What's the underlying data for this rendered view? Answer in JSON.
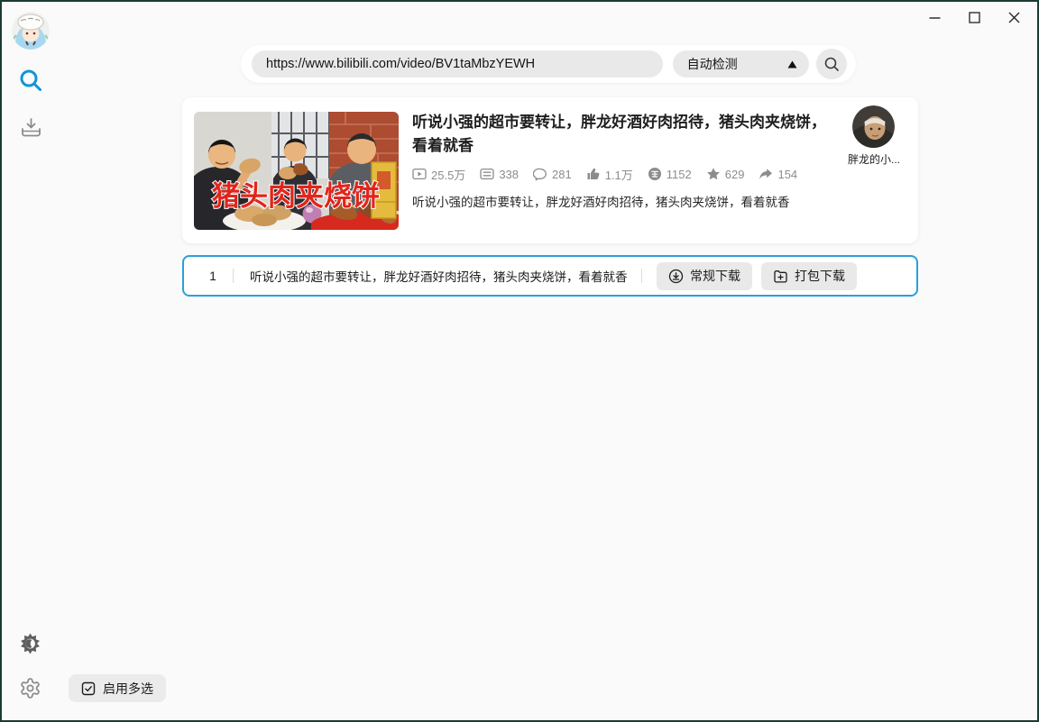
{
  "colors": {
    "accent_blue": "#28a0da",
    "sidebar_search_blue": "#1095d8",
    "window_border": "#1d3a34",
    "thumbnail_text_red": "#e1251b",
    "button_gray": "#e9e9e9"
  },
  "icons": [
    "app-avatar",
    "search-icon",
    "download-tray-icon",
    "theme-toggle-icon",
    "settings-gear-icon",
    "checkbox-checked-icon",
    "play-count-icon",
    "danmaku-icon",
    "comment-icon",
    "like-icon",
    "coin-icon",
    "favorite-star-icon",
    "share-icon",
    "cloud-download-icon",
    "package-add-icon",
    "magnifier-icon",
    "dropdown-up-triangle-icon",
    "minimize-icon",
    "maximize-icon",
    "close-icon"
  ],
  "search_bar": {
    "url": "https://www.bilibili.com/video/BV1taMbzYEWH",
    "detect_mode": "自动检测"
  },
  "video_card": {
    "title": "听说小强的超市要转让，胖龙好酒好肉招待，猪头肉夹烧饼，看着就香",
    "thumbnail_overlay_text": "猪头肉夹烧饼",
    "stats": [
      {
        "icon": "play-count-icon",
        "value": "25.5万"
      },
      {
        "icon": "danmaku-icon",
        "value": "338"
      },
      {
        "icon": "comment-icon",
        "value": "281"
      },
      {
        "icon": "like-icon",
        "value": "1.1万"
      },
      {
        "icon": "coin-icon",
        "value": "1152"
      },
      {
        "icon": "favorite-star-icon",
        "value": "629"
      },
      {
        "icon": "share-icon",
        "value": "154"
      }
    ],
    "description": "听说小强的超市要转让，胖龙好酒好肉招待，猪头肉夹烧饼，看着就香",
    "uploader_name": "胖龙的小..."
  },
  "download_list": {
    "rows": [
      {
        "index": "1",
        "title": "听说小强的超市要转让，胖龙好酒好肉招待，猪头肉夹烧饼，看着就香",
        "buttons": [
          "常规下载",
          "打包下载"
        ]
      }
    ]
  },
  "footer": {
    "multi_select": "启用多选"
  }
}
